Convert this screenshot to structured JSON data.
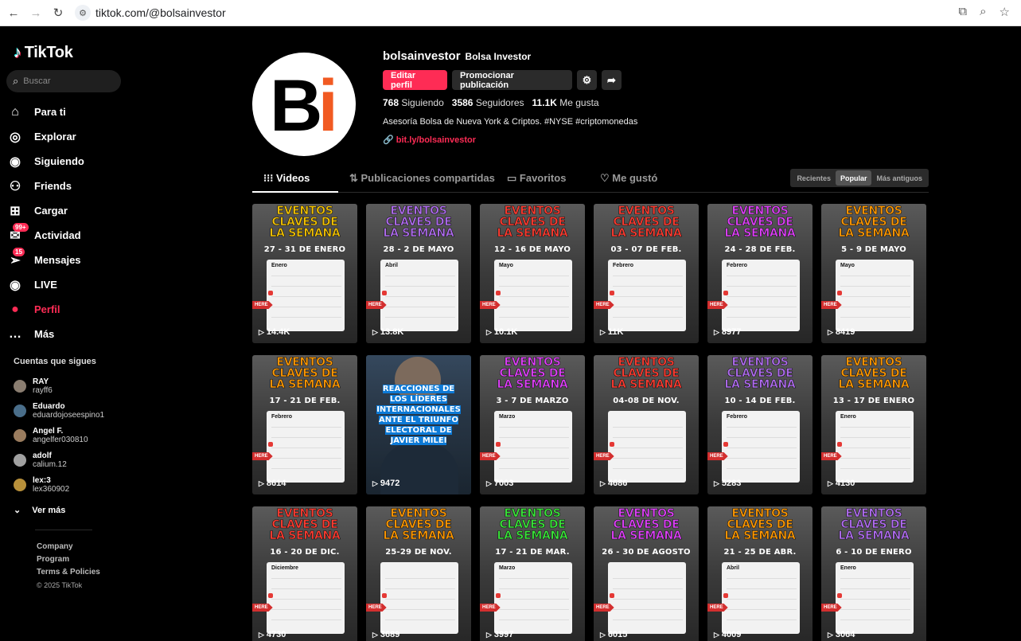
{
  "browser": {
    "url": "tiktok.com/@bolsainvestor",
    "back_icon": "arrow-left",
    "forward_icon": "arrow-right",
    "reload_icon": "reload"
  },
  "sidebar": {
    "brand": "TikTok",
    "search_placeholder": "Buscar",
    "items": [
      {
        "label": "Para ti",
        "icon": "home-icon"
      },
      {
        "label": "Explorar",
        "icon": "compass-icon"
      },
      {
        "label": "Siguiendo",
        "icon": "following-icon"
      },
      {
        "label": "Friends",
        "icon": "friends-icon"
      },
      {
        "label": "Cargar",
        "icon": "upload-icon"
      },
      {
        "label": "Actividad",
        "icon": "activity-icon",
        "badge": "99+"
      },
      {
        "label": "Mensajes",
        "icon": "messages-icon",
        "badge": "15"
      },
      {
        "label": "LIVE",
        "icon": "live-icon"
      },
      {
        "label": "Perfil",
        "icon": "profile-icon",
        "active": true
      },
      {
        "label": "Más",
        "icon": "more-icon"
      }
    ],
    "following_title": "Cuentas que sigues",
    "following": [
      {
        "name": "RAY",
        "handle": "rayff6",
        "color": "#8a7d70"
      },
      {
        "name": "Eduardo",
        "handle": "eduardojoseespino1",
        "color": "#4a6e8a"
      },
      {
        "name": "Angel F.",
        "handle": "angelfer030810",
        "color": "#9a7c5e"
      },
      {
        "name": "adolf",
        "handle": "calium.12",
        "color": "#a0a0a0"
      },
      {
        "name": "lex:3",
        "handle": "lex360902",
        "color": "#b8903a"
      }
    ],
    "see_more": "Ver más",
    "footer": {
      "company": "Company",
      "program": "Program",
      "terms": "Terms & Policies",
      "copyright": "© 2025 TikTok"
    }
  },
  "profile": {
    "username": "bolsainvestor",
    "display_name": "Bolsa Investor",
    "edit_label": "Editar perfil",
    "promote_label": "Promocionar publicación",
    "stats": [
      {
        "value": "768",
        "label": "Siguiendo"
      },
      {
        "value": "3586",
        "label": "Seguidores"
      },
      {
        "value": "11.1K",
        "label": "Me gusta"
      }
    ],
    "bio": "Asesoría Bolsa de Nueva York & Criptos. #NYSE #criptomonedas",
    "link": "bit.ly/bolsainvestor",
    "avatar_text_b": "B",
    "avatar_text_i": "i"
  },
  "tabs": {
    "items": [
      "Videos",
      "Publicaciones compartidas",
      "Favoritos",
      "Me gustó"
    ],
    "sort": [
      "Recientes",
      "Popular",
      "Más antiguos"
    ]
  },
  "videos": [
    {
      "title": "EVENTOS\nCLAVES DE\nLA SEMANA",
      "dates": "27 - 31 DE ENERO",
      "month": "Enero",
      "views": "14.4K",
      "color": "#f5c400"
    },
    {
      "title": "EVENTOS\nCLAVES DE\nLA SEMANA",
      "dates": "28 - 2 DE MAYO",
      "month": "Abril",
      "views": "13.8K",
      "color": "#b06cf0"
    },
    {
      "title": "EVENTOS\nCLAVES DE\nLA SEMANA",
      "dates": "12 - 16 DE MAYO",
      "month": "Mayo",
      "views": "10.1K",
      "color": "#ff3b30"
    },
    {
      "title": "EVENTOS\nCLAVES DE\nLA SEMANA",
      "dates": "03 - 07 DE FEB.",
      "month": "Febrero",
      "views": "11K",
      "color": "#ff3b30"
    },
    {
      "title": "EVENTOS\nCLAVES DE\nLA SEMANA",
      "dates": "24 - 28 DE FEB.",
      "month": "Febrero",
      "views": "8977",
      "color": "#e040fb"
    },
    {
      "title": "EVENTOS\nCLAVES DE\nLA SEMANA",
      "dates": "5 - 9 DE MAYO",
      "month": "Mayo",
      "views": "8419",
      "color": "#ff9800"
    },
    {
      "title": "EVENTOS\nCLAVES DE\nLA SEMANA",
      "dates": "17 - 21 DE FEB.",
      "month": "Febrero",
      "views": "8614",
      "color": "#ff9800"
    },
    {
      "special": "milei",
      "text": "REACCIONES DE\nLOS LÍDERES\nINTERNACIONALES\nANTE EL TRIUNFO\nELECTORAL DE\nJAVIER MILEI",
      "views": "9472"
    },
    {
      "title": "EVENTOS\nCLAVES DE\nLA SEMANA",
      "dates": "3 - 7 DE MARZO",
      "month": "Marzo",
      "views": "7003",
      "color": "#e040fb"
    },
    {
      "title": "EVENTOS\nCLAVES DE\nLA SEMANA",
      "dates": "04-08 DE NOV.",
      "month": "",
      "views": "4686",
      "color": "#ff3b30"
    },
    {
      "title": "EVENTOS\nCLAVES DE\nLA SEMANA",
      "dates": "10 - 14 DE FEB.",
      "month": "Febrero",
      "views": "5283",
      "color": "#b06cf0"
    },
    {
      "title": "EVENTOS\nCLAVES DE\nLA SEMANA",
      "dates": "13 - 17 DE ENERO",
      "month": "Enero",
      "views": "4130",
      "color": "#ff9800"
    },
    {
      "title": "EVENTOS\nCLAVES DE\nLA SEMANA",
      "dates": "16 - 20 DE DIC.",
      "month": "Diciembre",
      "views": "4730",
      "color": "#ff3b30"
    },
    {
      "title": "EVENTOS\nCLAVES DE\nLA SEMANA",
      "dates": "25-29 DE NOV.",
      "month": "",
      "views": "3689",
      "color": "#ff9800"
    },
    {
      "title": "EVENTOS\nCLAVES DE\nLA SEMANA",
      "dates": "17 - 21 DE MAR.",
      "month": "Marzo",
      "views": "3997",
      "color": "#39e639"
    },
    {
      "title": "EVENTOS\nCLAVES DE\nLA SEMANA",
      "dates": "26 - 30 DE AGOSTO",
      "month": "",
      "views": "6015",
      "color": "#e040fb"
    },
    {
      "title": "EVENTOS\nCLAVES DE\nLA SEMANA",
      "dates": "21 - 25 DE ABR.",
      "month": "Abril",
      "views": "4009",
      "color": "#ff9800"
    },
    {
      "title": "EVENTOS\nCLAVES DE\nLA SEMANA",
      "dates": "6 - 10 DE ENERO",
      "month": "Enero",
      "views": "3064",
      "color": "#b06cf0"
    }
  ]
}
